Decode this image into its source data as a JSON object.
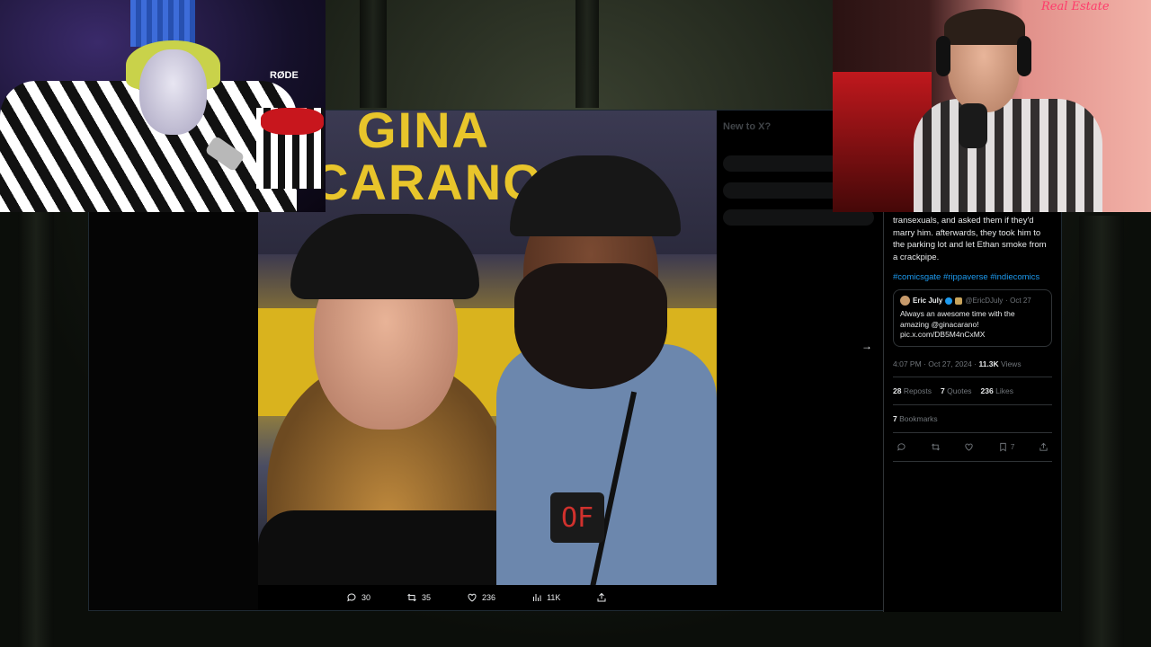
{
  "tweet": {
    "body": "transexuals, and asked them if they'd marry him. afterwards, they took him to the parking lot and let Ethan smoke from a crackpipe.",
    "hashtags": "#comicsgate #rippaverse #indiecomics",
    "quote": {
      "name": "Eric July",
      "handle": "@EricDJuly",
      "date": "· Oct 27",
      "text": "Always an awesome time with the amazing @ginacarano! pic.x.com/DB5M4nCxMX"
    },
    "time": "4:07 PM · Oct 27, 2024 ·",
    "views_count": "11.3K",
    "views_label": "Views",
    "reposts_count": "28",
    "reposts_label": "Reposts",
    "quotes_count": "7",
    "quotes_label": "Quotes",
    "likes_count": "236",
    "likes_label": "Likes",
    "bookmarks_count": "7",
    "bookmarks_label": "Bookmarks",
    "bookmark_action_count": "7"
  },
  "photo_toolbar": {
    "replies": "30",
    "reposts": "35",
    "likes": "236",
    "views": "11K"
  },
  "photo": {
    "banner_line1": "GINA",
    "banner_line2": "CARANO",
    "badge": "OF"
  },
  "sidebar_dim": {
    "title": "New to X?"
  },
  "overlay": {
    "mic_brand": "RØDE",
    "sign": "Real Estate"
  },
  "icons": {
    "reply": "reply-icon",
    "repost": "repost-icon",
    "like": "heart-icon",
    "views": "bar-chart-icon",
    "share": "share-icon",
    "bookmark": "bookmark-icon",
    "next": "arrow-right-icon"
  }
}
